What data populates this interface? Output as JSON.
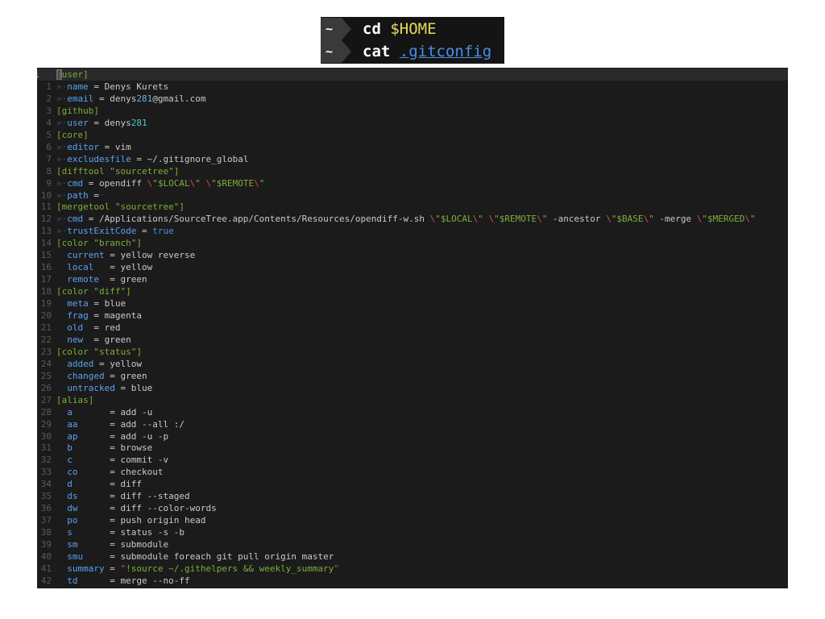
{
  "prompt": {
    "line1": {
      "tilde": "~",
      "cmd": "cd",
      "arg": "$HOME"
    },
    "line2": {
      "tilde": "~",
      "cmd": "cat",
      "arg": ".gitconfig"
    }
  },
  "editor": {
    "current_line_number": "1",
    "lines": [
      {
        "n": "",
        "parts": [
          [
            "sec",
            "["
          ],
          [
            "cur",
            "user"
          ],
          [
            "sec",
            "]"
          ]
        ]
      },
      {
        "n": "1",
        "parts": [
          [
            "tab",
            "»·"
          ],
          [
            "key",
            "name"
          ],
          [
            "eq",
            " = "
          ],
          [
            "val",
            "Denys Kurets"
          ]
        ]
      },
      {
        "n": "2",
        "parts": [
          [
            "tab",
            "»·"
          ],
          [
            "key",
            "email"
          ],
          [
            "eq",
            " = "
          ],
          [
            "val",
            "denys"
          ],
          [
            "num",
            "281"
          ],
          [
            "val",
            "@gmail.com"
          ]
        ]
      },
      {
        "n": "3",
        "parts": [
          [
            "sec",
            "[github]"
          ]
        ]
      },
      {
        "n": "4",
        "parts": [
          [
            "tab",
            "»·"
          ],
          [
            "key",
            "user"
          ],
          [
            "eq",
            " = "
          ],
          [
            "val",
            "denys"
          ],
          [
            "num",
            "281"
          ]
        ]
      },
      {
        "n": "5",
        "parts": [
          [
            "sec",
            "[core]"
          ]
        ]
      },
      {
        "n": "6",
        "parts": [
          [
            "tab",
            "»·"
          ],
          [
            "key",
            "editor"
          ],
          [
            "eq",
            " = "
          ],
          [
            "val",
            "vim"
          ]
        ]
      },
      {
        "n": "7",
        "parts": [
          [
            "tab",
            "»·"
          ],
          [
            "key",
            "excludesfile"
          ],
          [
            "eq",
            " = "
          ],
          [
            "val",
            "~/.gitignore_global"
          ]
        ]
      },
      {
        "n": "8",
        "parts": [
          [
            "sec",
            "[difftool "
          ],
          [
            "str",
            "\"sourcetree\""
          ],
          [
            "sec",
            "]"
          ]
        ]
      },
      {
        "n": "9",
        "parts": [
          [
            "tab",
            "»·"
          ],
          [
            "key",
            "cmd"
          ],
          [
            "eq",
            " = "
          ],
          [
            "val",
            "opendiff "
          ],
          [
            "esc",
            "\\"
          ],
          [
            "str",
            "\"$LOCAL"
          ],
          [
            "esc",
            "\\"
          ],
          [
            "str",
            "\" "
          ],
          [
            "esc",
            "\\"
          ],
          [
            "str",
            "\"$REMOTE"
          ],
          [
            "esc",
            "\\"
          ],
          [
            "str",
            "\""
          ]
        ]
      },
      {
        "n": "10",
        "parts": [
          [
            "tab",
            "»·"
          ],
          [
            "key",
            "path"
          ],
          [
            "eq",
            " ="
          ],
          [
            "tab",
            "·"
          ]
        ]
      },
      {
        "n": "11",
        "parts": [
          [
            "sec",
            "[mergetool "
          ],
          [
            "str",
            "\"sourcetree\""
          ],
          [
            "sec",
            "]"
          ]
        ]
      },
      {
        "n": "12",
        "parts": [
          [
            "tab",
            "»·"
          ],
          [
            "key",
            "cmd"
          ],
          [
            "eq",
            " = "
          ],
          [
            "val",
            "/Applications/SourceTree.app/Contents/Resources/opendiff-w.sh "
          ],
          [
            "esc",
            "\\"
          ],
          [
            "str",
            "\"$LOCAL"
          ],
          [
            "esc",
            "\\"
          ],
          [
            "str",
            "\" "
          ],
          [
            "esc",
            "\\"
          ],
          [
            "str",
            "\"$REMOTE"
          ],
          [
            "esc",
            "\\"
          ],
          [
            "str",
            "\""
          ],
          [
            "val",
            " -ancestor "
          ],
          [
            "esc",
            "\\"
          ],
          [
            "str",
            "\"$BASE"
          ],
          [
            "esc",
            "\\"
          ],
          [
            "str",
            "\""
          ],
          [
            "val",
            " -merge "
          ],
          [
            "esc",
            "\\"
          ],
          [
            "str",
            "\"$MERGED"
          ],
          [
            "esc",
            "\\"
          ],
          [
            "str",
            "\""
          ]
        ]
      },
      {
        "n": "13",
        "parts": [
          [
            "tab",
            "»·"
          ],
          [
            "key",
            "trustExitCode"
          ],
          [
            "eq",
            " = "
          ],
          [
            "tru",
            "true"
          ]
        ]
      },
      {
        "n": "14",
        "parts": [
          [
            "sec",
            "[color "
          ],
          [
            "str",
            "\"branch\""
          ],
          [
            "sec",
            "]"
          ]
        ]
      },
      {
        "n": "15",
        "parts": [
          [
            "val",
            "  "
          ],
          [
            "key",
            "current"
          ],
          [
            "eq",
            " = "
          ],
          [
            "val",
            "yellow reverse"
          ]
        ]
      },
      {
        "n": "16",
        "parts": [
          [
            "val",
            "  "
          ],
          [
            "key",
            "local"
          ],
          [
            "eq",
            "   = "
          ],
          [
            "val",
            "yellow"
          ]
        ]
      },
      {
        "n": "17",
        "parts": [
          [
            "val",
            "  "
          ],
          [
            "key",
            "remote"
          ],
          [
            "eq",
            "  = "
          ],
          [
            "val",
            "green"
          ]
        ]
      },
      {
        "n": "18",
        "parts": [
          [
            "sec",
            "[color "
          ],
          [
            "str",
            "\"diff\""
          ],
          [
            "sec",
            "]"
          ]
        ]
      },
      {
        "n": "19",
        "parts": [
          [
            "val",
            "  "
          ],
          [
            "key",
            "meta"
          ],
          [
            "eq",
            " = "
          ],
          [
            "val",
            "blue"
          ]
        ]
      },
      {
        "n": "20",
        "parts": [
          [
            "val",
            "  "
          ],
          [
            "key",
            "frag"
          ],
          [
            "eq",
            " = "
          ],
          [
            "val",
            "magenta"
          ]
        ]
      },
      {
        "n": "21",
        "parts": [
          [
            "val",
            "  "
          ],
          [
            "key",
            "old"
          ],
          [
            "eq",
            "  = "
          ],
          [
            "val",
            "red"
          ]
        ]
      },
      {
        "n": "22",
        "parts": [
          [
            "val",
            "  "
          ],
          [
            "key",
            "new"
          ],
          [
            "eq",
            "  = "
          ],
          [
            "val",
            "green"
          ]
        ]
      },
      {
        "n": "23",
        "parts": [
          [
            "sec",
            "[color "
          ],
          [
            "str",
            "\"status\""
          ],
          [
            "sec",
            "]"
          ]
        ]
      },
      {
        "n": "24",
        "parts": [
          [
            "val",
            "  "
          ],
          [
            "key",
            "added"
          ],
          [
            "eq",
            " = "
          ],
          [
            "val",
            "yellow"
          ]
        ]
      },
      {
        "n": "25",
        "parts": [
          [
            "val",
            "  "
          ],
          [
            "key",
            "changed"
          ],
          [
            "eq",
            " = "
          ],
          [
            "val",
            "green"
          ]
        ]
      },
      {
        "n": "26",
        "parts": [
          [
            "val",
            "  "
          ],
          [
            "key",
            "untracked"
          ],
          [
            "eq",
            " = "
          ],
          [
            "val",
            "blue"
          ]
        ]
      },
      {
        "n": "27",
        "parts": [
          [
            "sec",
            "[alias]"
          ]
        ]
      },
      {
        "n": "28",
        "parts": [
          [
            "val",
            "  "
          ],
          [
            "key",
            "a"
          ],
          [
            "eq",
            "       = "
          ],
          [
            "val",
            "add -u"
          ]
        ]
      },
      {
        "n": "29",
        "parts": [
          [
            "val",
            "  "
          ],
          [
            "key",
            "aa"
          ],
          [
            "eq",
            "      = "
          ],
          [
            "val",
            "add --all :/"
          ]
        ]
      },
      {
        "n": "30",
        "parts": [
          [
            "val",
            "  "
          ],
          [
            "key",
            "ap"
          ],
          [
            "eq",
            "      = "
          ],
          [
            "val",
            "add -u -p"
          ]
        ]
      },
      {
        "n": "31",
        "parts": [
          [
            "val",
            "  "
          ],
          [
            "key",
            "b"
          ],
          [
            "eq",
            "       = "
          ],
          [
            "val",
            "browse"
          ]
        ]
      },
      {
        "n": "32",
        "parts": [
          [
            "val",
            "  "
          ],
          [
            "key",
            "c"
          ],
          [
            "eq",
            "       = "
          ],
          [
            "val",
            "commit -v"
          ]
        ]
      },
      {
        "n": "33",
        "parts": [
          [
            "val",
            "  "
          ],
          [
            "key",
            "co"
          ],
          [
            "eq",
            "      = "
          ],
          [
            "val",
            "checkout"
          ]
        ]
      },
      {
        "n": "34",
        "parts": [
          [
            "val",
            "  "
          ],
          [
            "key",
            "d"
          ],
          [
            "eq",
            "       = "
          ],
          [
            "val",
            "diff"
          ]
        ]
      },
      {
        "n": "35",
        "parts": [
          [
            "val",
            "  "
          ],
          [
            "key",
            "ds"
          ],
          [
            "eq",
            "      = "
          ],
          [
            "val",
            "diff --staged"
          ]
        ]
      },
      {
        "n": "36",
        "parts": [
          [
            "val",
            "  "
          ],
          [
            "key",
            "dw"
          ],
          [
            "eq",
            "      = "
          ],
          [
            "val",
            "diff --color-words"
          ]
        ]
      },
      {
        "n": "37",
        "parts": [
          [
            "val",
            "  "
          ],
          [
            "key",
            "po"
          ],
          [
            "eq",
            "      = "
          ],
          [
            "val",
            "push origin head"
          ]
        ]
      },
      {
        "n": "38",
        "parts": [
          [
            "val",
            "  "
          ],
          [
            "key",
            "s"
          ],
          [
            "eq",
            "       = "
          ],
          [
            "val",
            "status -s -b"
          ]
        ]
      },
      {
        "n": "39",
        "parts": [
          [
            "val",
            "  "
          ],
          [
            "key",
            "sm"
          ],
          [
            "eq",
            "      = "
          ],
          [
            "val",
            "submodule"
          ]
        ]
      },
      {
        "n": "40",
        "parts": [
          [
            "val",
            "  "
          ],
          [
            "key",
            "smu"
          ],
          [
            "eq",
            "     = "
          ],
          [
            "val",
            "submodule foreach git pull origin master"
          ]
        ]
      },
      {
        "n": "41",
        "parts": [
          [
            "val",
            "  "
          ],
          [
            "key",
            "summary"
          ],
          [
            "eq",
            " = "
          ],
          [
            "esc",
            "\""
          ],
          [
            "str",
            "!source ~/.githelpers && weekly_summary"
          ],
          [
            "esc",
            "\""
          ]
        ]
      },
      {
        "n": "42",
        "parts": [
          [
            "val",
            "  "
          ],
          [
            "key",
            "td"
          ],
          [
            "eq",
            "      = "
          ],
          [
            "val",
            "merge --no-ff"
          ]
        ]
      }
    ]
  }
}
